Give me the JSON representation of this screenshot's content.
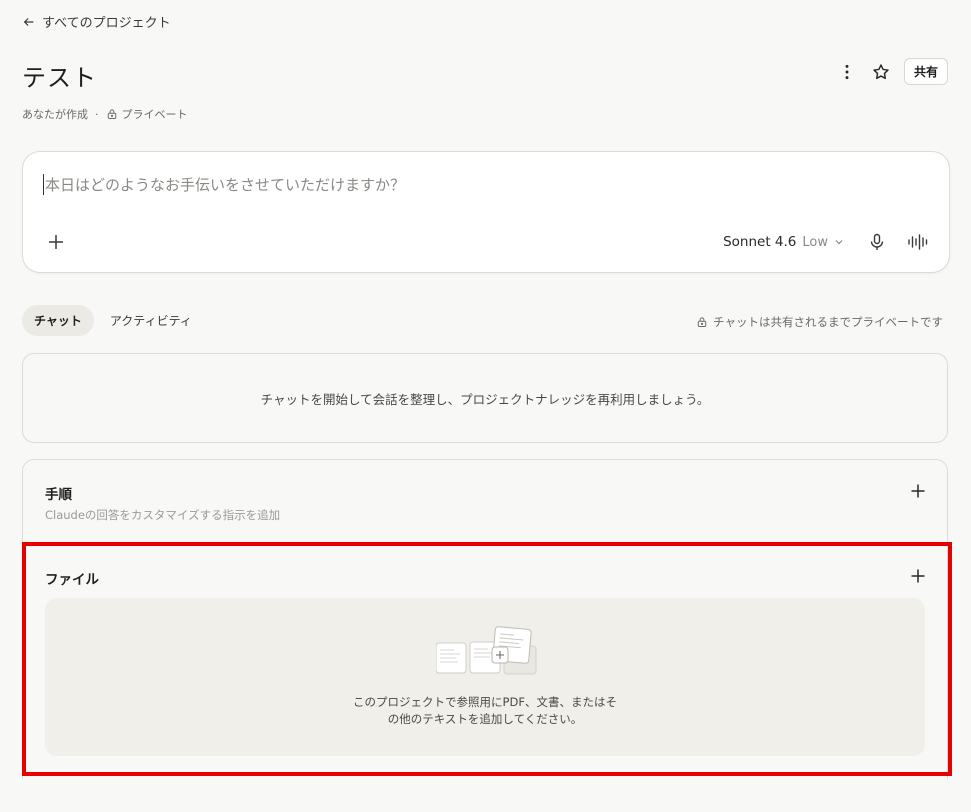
{
  "nav": {
    "back_label": "すべてのプロジェクト"
  },
  "project": {
    "title": "テスト",
    "created_by": "あなたが作成",
    "separator": "·",
    "visibility": "プライベート"
  },
  "top_actions": {
    "share_label": "共有",
    "more_icon": "more-vertical-icon",
    "star_icon": "star-icon"
  },
  "composer": {
    "placeholder": "本日はどのようなお手伝いをさせていただけますか？",
    "model": "Sonnet 4.6",
    "effort": "Low"
  },
  "tabs": [
    {
      "label": "チャット",
      "active": true
    },
    {
      "label": "アクティビティ",
      "active": false
    }
  ],
  "private_note": "チャットは共有されるまでプライベートです",
  "empty_state": "チャットを開始して会話を整理し、プロジェクトナレッジを再利用しましょう。",
  "instructions": {
    "title": "手順",
    "subtitle": "Claudeの回答をカスタマイズする指示を追加"
  },
  "files": {
    "title": "ファイル",
    "hint_line1": "このプロジェクトで参照用にPDF、文書、またはそ",
    "hint_line2": "の他のテキストを追加してください。"
  },
  "colors": {
    "highlight": "#e60000",
    "background": "#f8f8f6",
    "dropzone": "#f0efea"
  }
}
